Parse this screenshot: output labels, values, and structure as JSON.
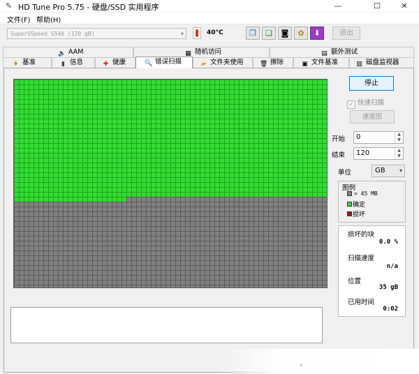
{
  "window": {
    "title": "HD Tune Pro 5.75 - 硬盘/SSD 实用程序",
    "controls": {
      "minimize": "—",
      "maximize": "☐",
      "close": "✕"
    }
  },
  "menu": {
    "file": "文件(F)",
    "help": "帮助(H)"
  },
  "toolbar": {
    "device": "SuperSSpeed S540 (120 gB)",
    "temperature": "40°C",
    "exit_label": "退出",
    "icons": [
      "copy-info-icon",
      "copy-text-icon",
      "camera-icon",
      "options-icon",
      "save-icon"
    ]
  },
  "tabs": {
    "row1": [
      {
        "label": "AAM",
        "icon": "speaker-icon"
      },
      {
        "label": "随机访问",
        "icon": "random-access-icon"
      },
      {
        "label": "额外测试",
        "icon": "extra-tests-icon"
      }
    ],
    "row2": [
      {
        "label": "基准",
        "icon": "benchmark-icon"
      },
      {
        "label": "信息",
        "icon": "info-icon"
      },
      {
        "label": "健康",
        "icon": "health-icon"
      },
      {
        "label": "错误扫描",
        "icon": "magnifier-icon",
        "active": true
      },
      {
        "label": "文件夹使用",
        "icon": "folder-icon"
      },
      {
        "label": "擦除",
        "icon": "trash-icon"
      },
      {
        "label": "文件基准",
        "icon": "file-benchmark-icon"
      },
      {
        "label": "磁盘监视器",
        "icon": "disk-monitor-icon"
      }
    ]
  },
  "scan": {
    "stop_label": "停止",
    "quick_scan_label": "快速扫描",
    "speed_label": "速度图",
    "start_label": "开始",
    "start_value": "0",
    "end_label": "结束",
    "end_value": "120",
    "unit_label": "单位",
    "unit_value": "GB",
    "progress_fraction": 0.58
  },
  "legend": {
    "title": "图例",
    "block_size": "= 45 MB",
    "ok_label": "确定",
    "damaged_label": "损坏",
    "colors": {
      "unscanned": "#808080",
      "ok": "#33dd33",
      "damaged": "#a01818"
    }
  },
  "stats": {
    "damaged_blocks_label": "损坏的块",
    "damaged_blocks_value": "0.0 %",
    "scan_speed_label": "扫描速度",
    "scan_speed_value": "n/a",
    "position_label": "位置",
    "position_value": "35 gB",
    "elapsed_label": "已用时间",
    "elapsed_value": "0:02"
  }
}
